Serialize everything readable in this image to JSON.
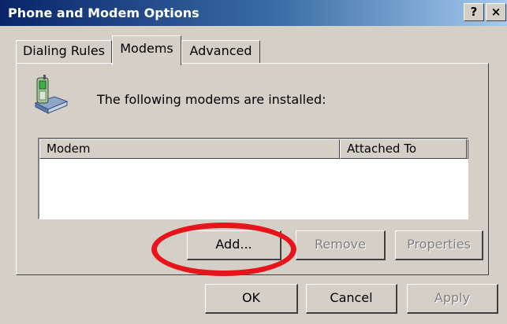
{
  "window": {
    "title": "Phone and Modem Options",
    "help_button": "?",
    "close_button": "×"
  },
  "tabs": [
    {
      "label": "Dialing Rules",
      "selected": false
    },
    {
      "label": "Modems",
      "selected": true
    },
    {
      "label": "Advanced",
      "selected": false
    }
  ],
  "panel": {
    "icon": "modem-phone-icon",
    "installed_text": "The following modems are  installed:",
    "list": {
      "columns": [
        "Modem",
        "Attached To"
      ],
      "rows": []
    },
    "buttons": {
      "add": "Add...",
      "remove": "Remove",
      "properties": "Properties"
    }
  },
  "dialog_buttons": {
    "ok": "OK",
    "cancel": "Cancel",
    "apply": "Apply"
  },
  "colors": {
    "face": "#d4d0c8",
    "title_start": "#0a246a",
    "title_end": "#a6caf0",
    "annotation": "#e8141c"
  }
}
